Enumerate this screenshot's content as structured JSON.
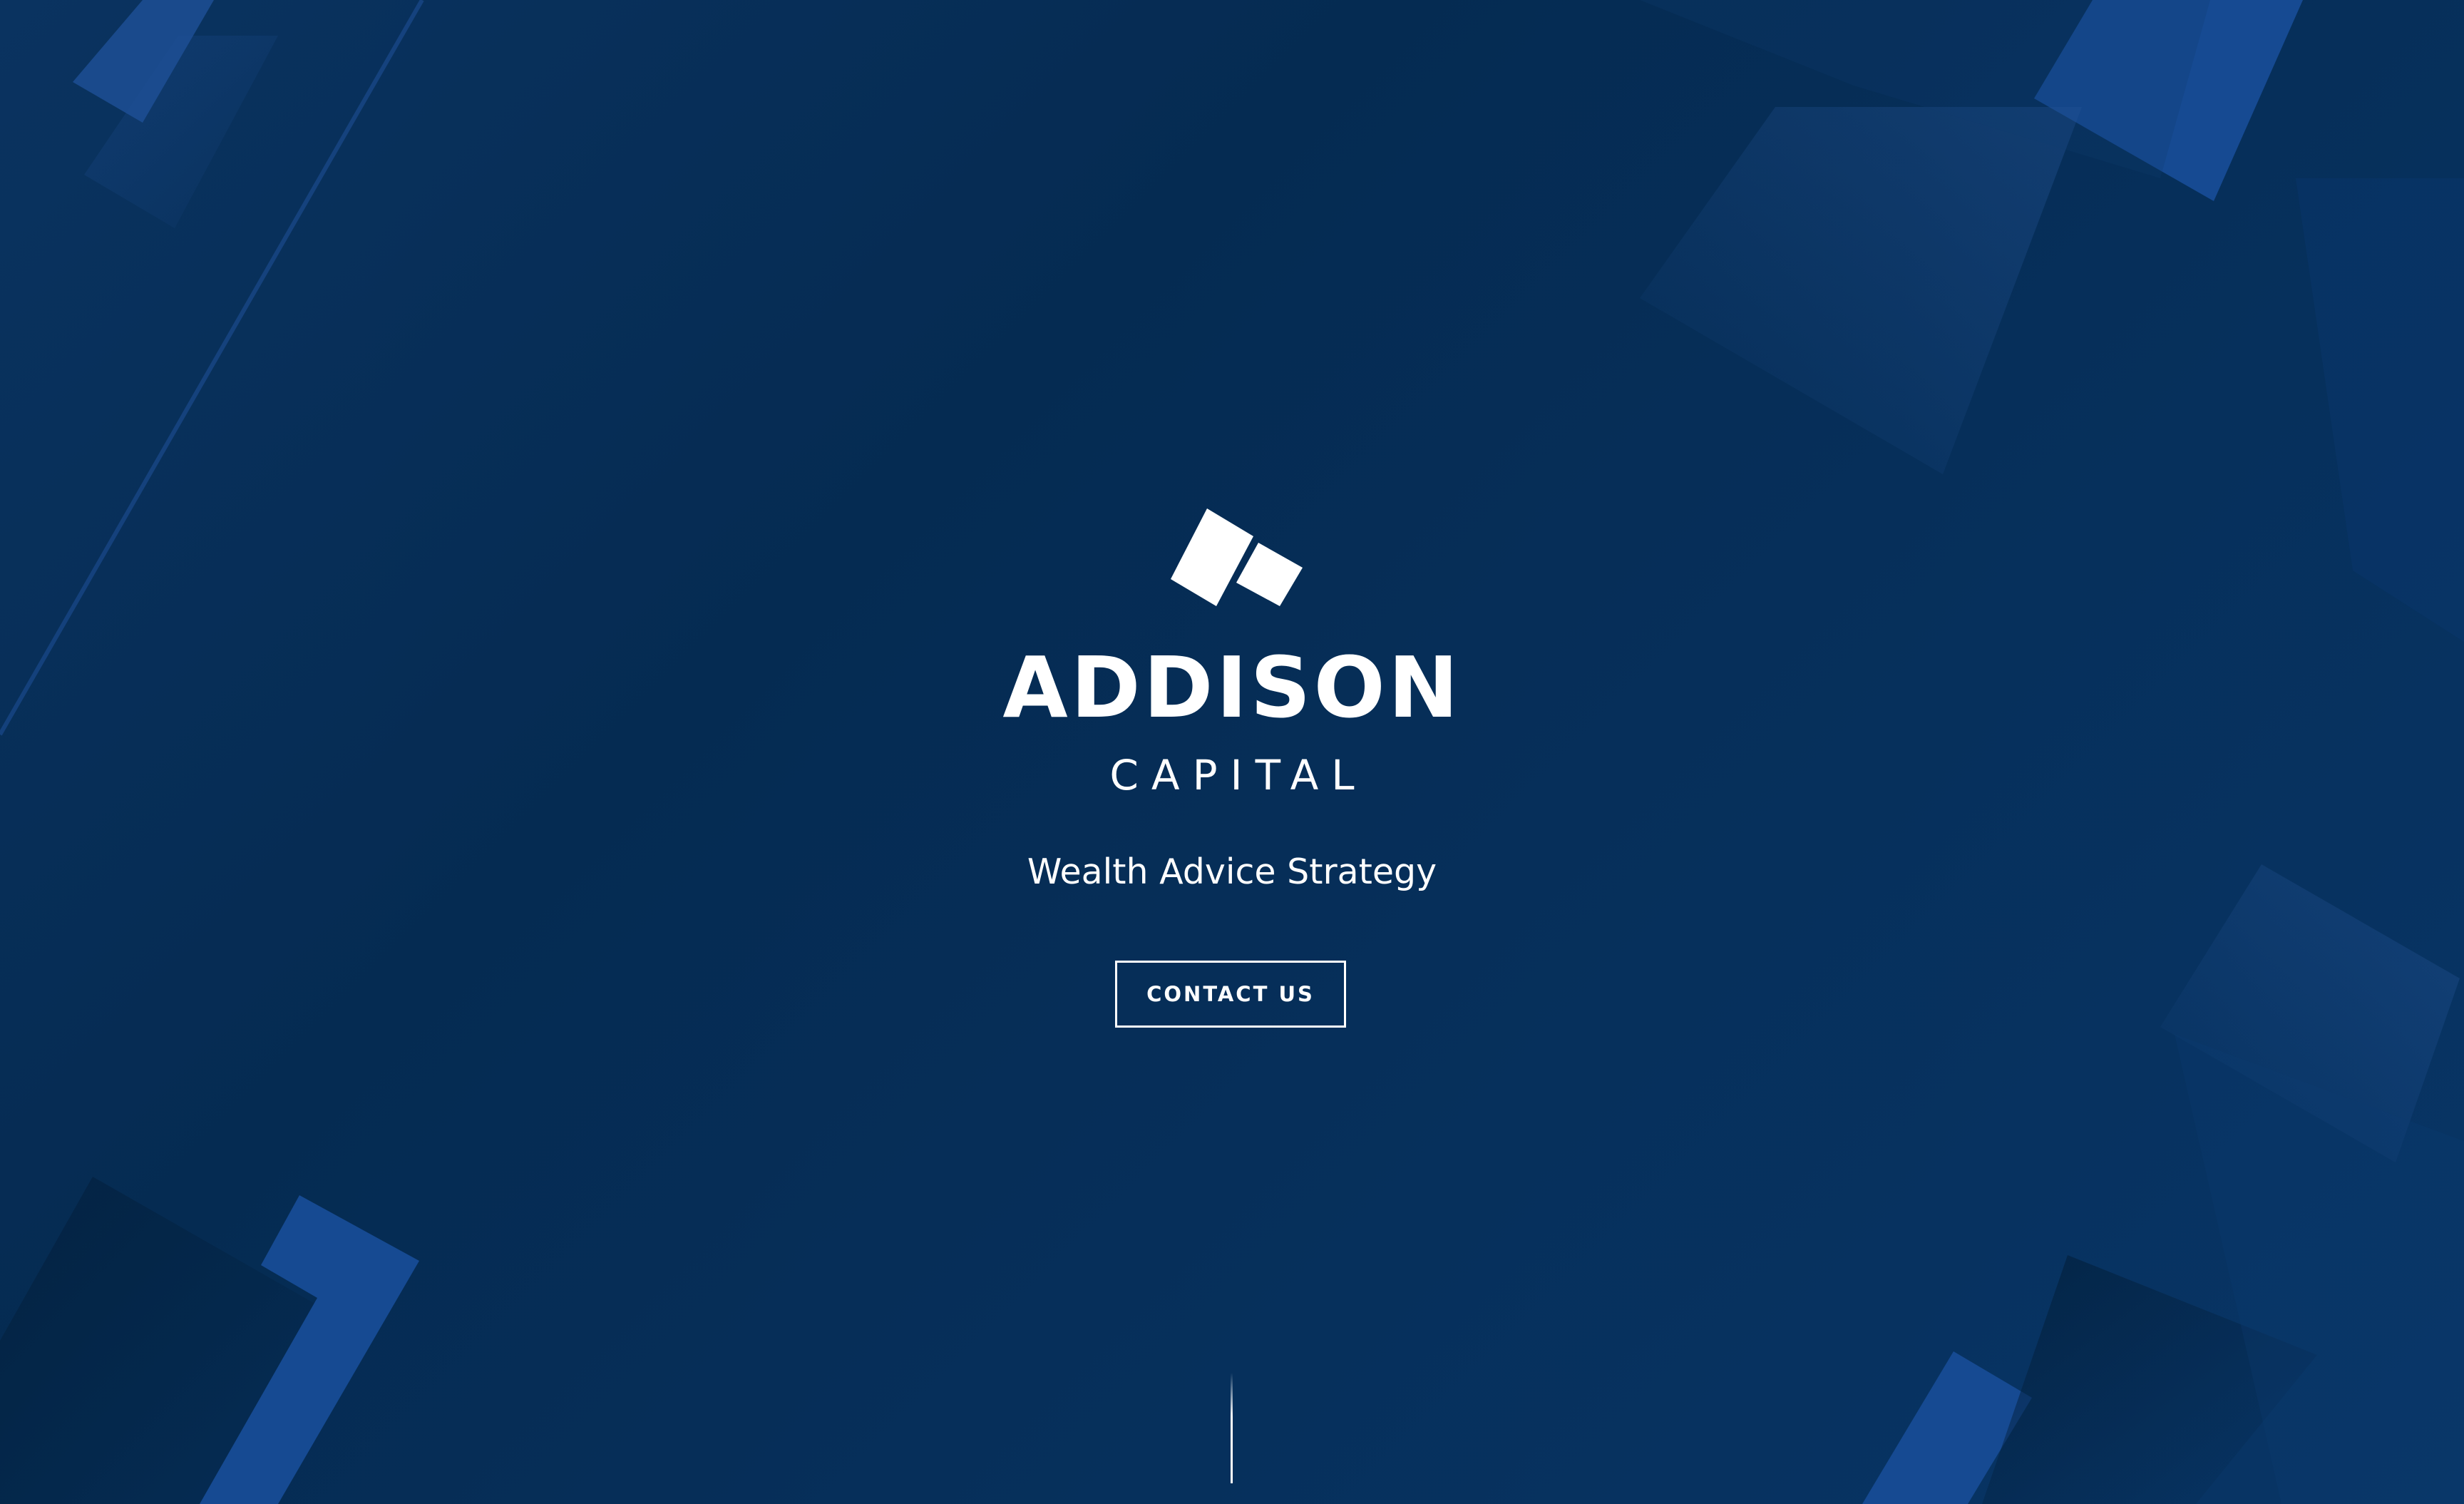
{
  "brand": {
    "name": "ADDISON",
    "subtitle": "CAPITAL",
    "logo_icon": "addison-capital-logo-mark"
  },
  "hero": {
    "tagline": "Wealth Advice Strategy",
    "cta_label": "CONTACT US"
  },
  "colors": {
    "background": "#052b52",
    "accent_shape": "#1e4f94",
    "text": "#ffffff"
  }
}
